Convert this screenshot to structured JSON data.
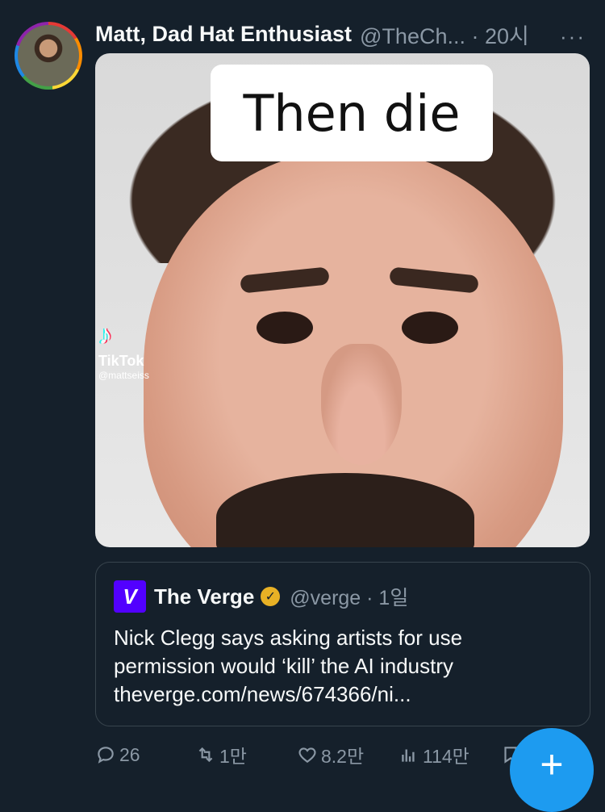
{
  "tweet": {
    "display_name": "Matt, Dad Hat Enthusiast",
    "handle_time": "@TheCh... · 20시",
    "more_label": "···",
    "media": {
      "caption": "Then die",
      "tiktok_label": "TikTok",
      "tiktok_user": "@mattseiss"
    }
  },
  "quoted": {
    "logo_letter": "V",
    "name": "The Verge",
    "badge": "✓",
    "handle_time": "@verge · 1일",
    "lines": [
      "Nick Clegg says asking artists for use",
      "permission would ‘kill’ the AI industry",
      "theverge.com/news/674366/ni..."
    ]
  },
  "actions": {
    "replies": "26",
    "retweets": "1만",
    "likes": "8.2만",
    "views": "114만"
  },
  "fab_label": "+",
  "colors": {
    "background": "#15202b",
    "accent": "#1d9bf0",
    "muted": "#8b98a5",
    "verge_purple": "#5200ff",
    "gold_badge": "#e8b125"
  }
}
